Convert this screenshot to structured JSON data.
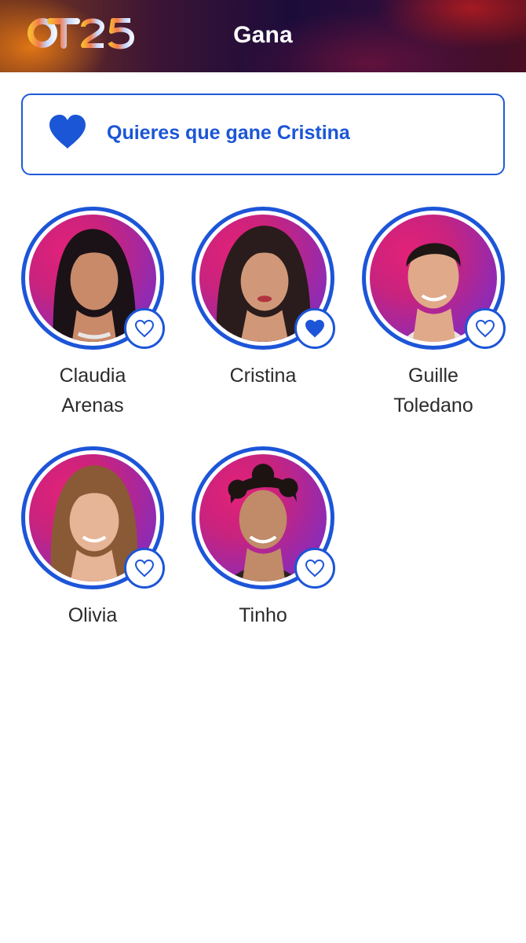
{
  "app": {
    "logo_text": "OT25",
    "title": "Gana"
  },
  "vote": {
    "message": "Quieres que gane Cristina",
    "selected": "Cristina"
  },
  "colors": {
    "accent": "#1d55d8",
    "text": "#2b2b2b",
    "header_dark": "#1c0c3a"
  },
  "contestants": [
    {
      "first": "Claudia",
      "last": "Arenas",
      "selected": false,
      "icon": "heart-outline-icon"
    },
    {
      "first": "Cristina",
      "last": "",
      "selected": true,
      "icon": "heart-filled-icon"
    },
    {
      "first": "Guille",
      "last": "Toledano",
      "selected": false,
      "icon": "heart-outline-icon"
    },
    {
      "first": "Olivia",
      "last": "",
      "selected": false,
      "icon": "heart-outline-icon"
    },
    {
      "first": "Tinho",
      "last": "",
      "selected": false,
      "icon": "heart-outline-icon"
    }
  ]
}
